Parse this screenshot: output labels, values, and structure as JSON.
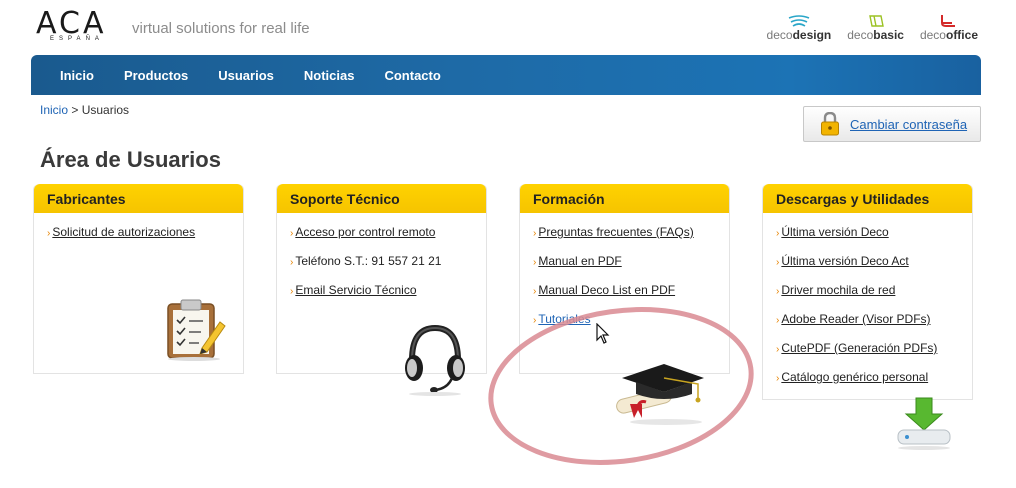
{
  "header": {
    "logo_text": "ACA",
    "logo_sub": "ESPAÑA",
    "tagline": "virtual solutions for real life",
    "brands": [
      {
        "prefix": "deco",
        "bold": "design",
        "icon": "decodesign-icon",
        "color": "#2aa6c8"
      },
      {
        "prefix": "deco",
        "bold": "basic",
        "icon": "decobasic-icon",
        "color": "#9cc224"
      },
      {
        "prefix": "deco",
        "bold": "office",
        "icon": "decooffice-icon",
        "color": "#d42a2a"
      }
    ]
  },
  "nav": {
    "items": [
      "Inicio",
      "Productos",
      "Usuarios",
      "Noticias",
      "Contacto"
    ]
  },
  "breadcrumb": {
    "home": "Inicio",
    "separator": " > ",
    "current": "Usuarios"
  },
  "password_button": {
    "label": "Cambiar contraseña",
    "icon": "padlock-icon"
  },
  "page_title": "Área de Usuarios",
  "cards": [
    {
      "title": "Fabricantes",
      "icon": "clipboard-icon",
      "items": [
        {
          "text": "Solicitud de autorizaciones",
          "link": true
        }
      ]
    },
    {
      "title": "Soporte Técnico",
      "icon": "headset-icon",
      "items": [
        {
          "text": "Acceso por control remoto",
          "link": true
        },
        {
          "text": "Teléfono S.T.: 91 557 21 21",
          "link": false
        },
        {
          "text": "Email Servicio Técnico",
          "link": true
        }
      ]
    },
    {
      "title": "Formación",
      "icon": "graduation-cap-icon",
      "items": [
        {
          "text": "Preguntas frecuentes (FAQs)",
          "link": true
        },
        {
          "text": "Manual en PDF",
          "link": true
        },
        {
          "text": "Manual Deco List en PDF",
          "link": true
        },
        {
          "text": "Tutoriales",
          "link": true,
          "active": true
        }
      ]
    },
    {
      "title": "Descargas y Utilidades",
      "icon": "download-icon",
      "items": [
        {
          "text": "Última versión Deco",
          "link": true
        },
        {
          "text": "Última versión Deco Act",
          "link": true
        },
        {
          "text": "Driver mochila de red",
          "link": true
        },
        {
          "text": "Adobe Reader (Visor PDFs)",
          "link": true
        },
        {
          "text": "CutePDF (Generación PDFs)",
          "link": true
        },
        {
          "text": "Catálogo genérico personal",
          "link": true
        }
      ]
    }
  ],
  "colors": {
    "nav": "#1c6aa8",
    "card_header": "#ffd200",
    "link": "#1f64b5",
    "arrow": "#e88400",
    "highlight": "#d98a92"
  }
}
